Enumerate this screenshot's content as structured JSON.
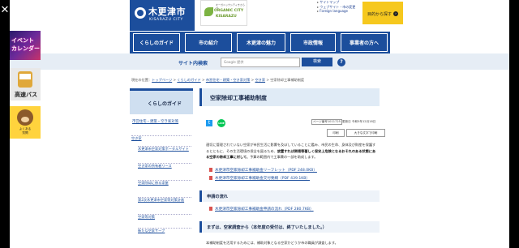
{
  "window": {
    "close_label": "✕"
  },
  "header": {
    "logo_jp": "木更津市",
    "logo_en": "KISARAZU CITY",
    "organic_line1": "オーガニックシティきさらづ",
    "organic_line2": "ORGANIC CITY",
    "organic_line3": "KISARAZU",
    "links": [
      "サイトマップ",
      "ウェブサイト・市の変更",
      "Foreign language"
    ],
    "mokuteki_label": "目的から探す"
  },
  "nav": [
    "くらしのガイド",
    "市の紹介",
    "木更津の魅力",
    "市政情報",
    "事業者の方へ"
  ],
  "search": {
    "label": "サイト内検索",
    "placeholder": "Google 提供",
    "button": "検索",
    "help": "?"
  },
  "banners": {
    "event": "イベント\nカレンダー",
    "bus": "高速バス",
    "kuma": "よくある\n質問"
  },
  "breadcrumb": {
    "prefix": "現在の位置：",
    "items": [
      "トップページ",
      "くらしのガイド",
      "市営住宅・建築・空き家対策",
      "空き家",
      "空家除却工事補助制度"
    ]
  },
  "left_menu": {
    "title": "くらしのガイド",
    "category": "市営住宅・建築・空き家対策",
    "items": [
      "空き家",
      "木更津市空家対策ポータルサイト",
      "空き家の所有者リース",
      "空家除却に係る家屋",
      "第2次木更津市空家等対策計画",
      "空家等対策",
      "新たな空家サーブ"
    ]
  },
  "main": {
    "title": "空家除却工事補助制度",
    "tw_icon": "t",
    "line_icon": "LINE",
    "page_number": "ページ番号1011725",
    "updated": "更新日 令和5年12月18日",
    "print": "印刷",
    "print_large": "大きな文字で印刷",
    "intro": "適切に管理されていない空家が市民生活に影響を及ぼしていることに鑑み、市民の生命、身体及び財産を保護するとともに、その生活環境の保全を図るため、",
    "intro_bold": "放置すれば倒壊等著しく保安上危険となるおそれのある状態にある空家の除却工事に対して、",
    "intro_end": "予算の範囲内で工事費の一部を助成します。",
    "pdfs": [
      "木更津市空家除却工事補助金リーフレット（PDF 248.0KB）",
      "木更津市空家除却工事補助金交付要綱（PDF 439.1KB）"
    ],
    "h2_flow": "申請の流れ",
    "pdf_flow": "木更津市空家除却工事補助金申請の流れ（PDF 280.7KB）",
    "h2_step1": "まずは、空家調査から（本年度の受付は、終了いたしました。）",
    "step1_text": "本補助制度を活用するためには、補助対象となる空家かどうか市の職員が調査します。"
  }
}
